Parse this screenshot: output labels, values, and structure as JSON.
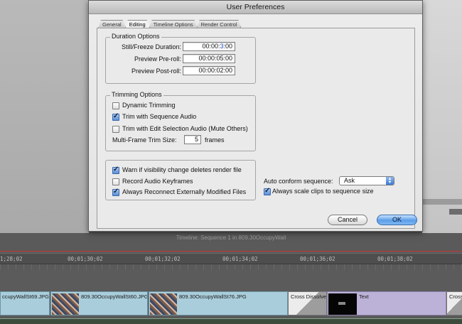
{
  "dialog": {
    "title": "User Preferences",
    "tabs": [
      "General",
      "Editing",
      "Timeline Options",
      "Render Control"
    ],
    "active_tab": "Editing",
    "duration_options": {
      "title": "Duration Options",
      "still_freeze_label": "Still/Freeze Duration:",
      "still_freeze_value_prefix": "00:00:",
      "still_freeze_value_highlight": "3",
      "still_freeze_value_suffix": ":00",
      "preview_preroll_label": "Preview Pre-roll:",
      "preview_preroll_value": "00:00:05:00",
      "preview_postroll_label": "Preview Post-roll:",
      "preview_postroll_value": "00:00:02:00"
    },
    "trimming_options": {
      "title": "Trimming Options",
      "dynamic_trimming": {
        "label": "Dynamic Trimming",
        "checked": false
      },
      "trim_sequence_audio": {
        "label": "Trim with Sequence Audio",
        "checked": true
      },
      "trim_edit_selection_audio": {
        "label": "Trim with Edit Selection Audio (Mute Others)",
        "checked": false
      },
      "multiframe_label": "Multi-Frame Trim Size:",
      "multiframe_value": "5",
      "multiframe_unit": "frames"
    },
    "misc_options": {
      "warn_visibility": {
        "label": "Warn if visibility change deletes render file",
        "checked": true
      },
      "record_audio_keyframes": {
        "label": "Record Audio Keyframes",
        "checked": false
      },
      "always_reconnect": {
        "label": "Always Reconnect Externally Modified Files",
        "checked": true
      }
    },
    "auto_conform": {
      "label": "Auto conform sequence:",
      "value": "Ask"
    },
    "always_scale": {
      "label": "Always scale clips to sequence size",
      "checked": true
    },
    "cancel_label": "Cancel",
    "ok_label": "OK"
  },
  "timeline": {
    "title": "Timeline: Sequence 1 in 809.30OccupyWall",
    "ruler": [
      "1;28;02",
      "00;01;30;02",
      "00;01;32;02",
      "00;01;34;02",
      "00;01;36;02",
      "00;01;38;02"
    ],
    "clips": [
      "ccupyWallSt69.JPG",
      "809.30OccupyWallSt60.JPG",
      "809.30OccupyWallSt76.JPG",
      "Cross Dissolve",
      "Text",
      "Cross"
    ]
  }
}
